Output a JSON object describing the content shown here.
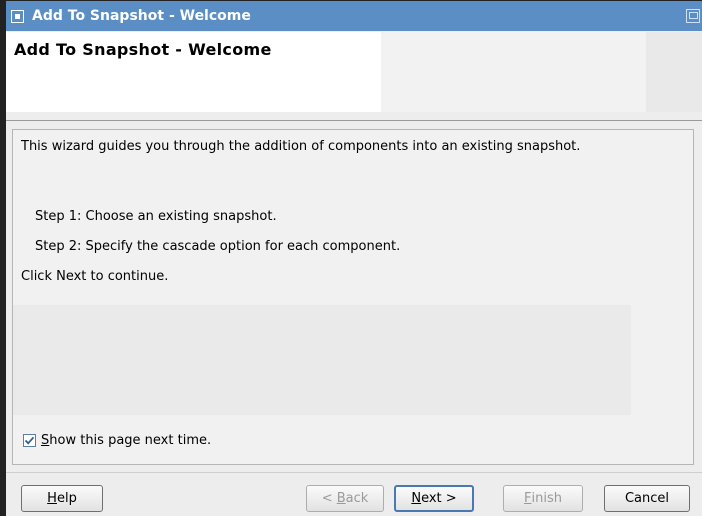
{
  "window": {
    "title": "Add To Snapshot - Welcome"
  },
  "header": {
    "title": "Add To Snapshot - Welcome"
  },
  "body": {
    "intro": "This wizard guides you through the addition of components into an existing snapshot.",
    "step1": "Step 1: Choose an existing snapshot.",
    "step2": "Step 2: Specify the cascade option for each component.",
    "continue": "Click Next to continue."
  },
  "checkbox": {
    "mnemonic": "S",
    "label_rest": "how this page next time.",
    "checked": true
  },
  "buttons": {
    "help_mn": "H",
    "help_rest": "elp",
    "back_prefix": "< ",
    "back_mn": "B",
    "back_rest": "ack",
    "next_mn": "N",
    "next_rest": "ext >",
    "finish_mn": "F",
    "finish_rest": "inish",
    "cancel": "Cancel"
  },
  "colors": {
    "titlebar": "#5a8ec4",
    "default_button_border": "#4a78b0"
  }
}
